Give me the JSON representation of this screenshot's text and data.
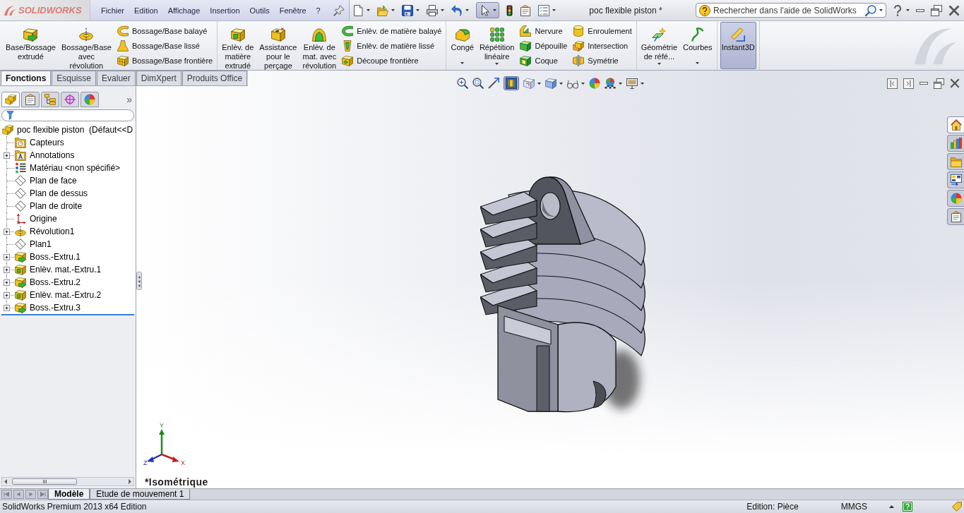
{
  "app_bar": {
    "logo": "SOLIDWORKS",
    "menu": [
      "Fichier",
      "Edition",
      "Affichage",
      "Insertion",
      "Outils",
      "Fenêtre",
      "?"
    ],
    "select_tool": {
      "pressed": true
    },
    "document_title": "poc flexible piston *",
    "search": {
      "placeholder": "Rechercher dans l'aide de SolidWorks"
    }
  },
  "ribbon": {
    "groups": [
      {
        "items": [
          {
            "kind": "large",
            "label": "Base/Bossage\nextrudé",
            "pressed": false
          },
          {
            "kind": "large",
            "label": "Bossage/Base\navec\nrévolution",
            "pressed": false
          },
          {
            "kind": "stack",
            "entries": [
              "Bossage/Base balayé",
              "Bossage/Base lissé",
              "Bossage/Base frontière"
            ]
          }
        ]
      },
      {
        "items": [
          {
            "kind": "large",
            "label": "Enlèv. de\nmatière\nextrudé",
            "pressed": false
          },
          {
            "kind": "large",
            "label": "Assistance\npour le\nperçage",
            "pressed": false
          },
          {
            "kind": "large",
            "label": "Enlèv. de\nmat. avec\nrévolution",
            "pressed": false
          },
          {
            "kind": "stack",
            "entries": [
              "Enlèv. de matière balayé",
              "Enlèv. de matière lissé",
              "Découpe frontière"
            ]
          }
        ]
      },
      {
        "items": [
          {
            "kind": "large",
            "label": "Congé",
            "dropdown": true,
            "pressed": false
          },
          {
            "kind": "large",
            "label": "Répétition\nlinéaire",
            "dropdown": true,
            "pressed": false
          },
          {
            "kind": "stack",
            "entries": [
              "Nervure",
              "Dépouille",
              "Coque"
            ]
          },
          {
            "kind": "stack",
            "entries": [
              "Enroulement",
              "Intersection",
              "Symétrie"
            ]
          }
        ]
      },
      {
        "items": [
          {
            "kind": "large",
            "label": "Géométrie\nde réfé...",
            "dropdown": true,
            "pressed": false
          },
          {
            "kind": "large",
            "label": "Courbes",
            "dropdown": true,
            "pressed": false
          }
        ]
      },
      {
        "items": [
          {
            "kind": "large",
            "label": "Instant3D",
            "pressed": true
          }
        ]
      }
    ]
  },
  "command_tabs": [
    {
      "label": "Fonctions",
      "selected": true
    },
    {
      "label": "Esquisse",
      "selected": false
    },
    {
      "label": "Evaluer",
      "selected": false
    },
    {
      "label": "DimXpert",
      "selected": false
    },
    {
      "label": "Produits Office",
      "selected": false
    }
  ],
  "view_toolbar": {
    "section_view": {
      "pressed": true
    }
  },
  "feature_manager": {
    "tabs": [
      {
        "selected": true
      },
      {
        "selected": false
      },
      {
        "selected": false
      },
      {
        "selected": false
      },
      {
        "selected": false
      }
    ],
    "more": "»",
    "tree": {
      "label": "poc flexible piston  (Défaut<<D",
      "children": [
        {
          "label": "Capteurs",
          "kind": "sensors",
          "expander": false
        },
        {
          "label": "Annotations",
          "kind": "annotations",
          "expander": true
        },
        {
          "label": "Matériau <non spécifié>",
          "kind": "material",
          "expander": false
        },
        {
          "label": "Plan de face",
          "kind": "plane",
          "expander": false
        },
        {
          "label": "Plan de dessus",
          "kind": "plane",
          "expander": false
        },
        {
          "label": "Plan de droite",
          "kind": "plane",
          "expander": false
        },
        {
          "label": "Origine",
          "kind": "origin",
          "expander": false
        },
        {
          "label": "Révolution1",
          "kind": "revolve",
          "expander": true
        },
        {
          "label": "Plan1",
          "kind": "plane",
          "expander": false
        },
        {
          "label": "Boss.-Extru.1",
          "kind": "boss",
          "expander": true
        },
        {
          "label": "Enlèv. mat.-Extru.1",
          "kind": "cut",
          "expander": true
        },
        {
          "label": "Boss.-Extru.2",
          "kind": "boss",
          "expander": true
        },
        {
          "label": "Enlèv. mat.-Extru.2",
          "kind": "cut",
          "expander": true
        },
        {
          "label": "Boss.-Extru.3",
          "kind": "boss",
          "expander": true
        }
      ]
    }
  },
  "viewport": {
    "view_name": "*Isométrique",
    "triad": {
      "y": "Y",
      "x": "X",
      "z": "Z"
    }
  },
  "task_pane": [
    {
      "selected": true
    },
    {
      "selected": false
    },
    {
      "selected": false
    },
    {
      "selected": false
    },
    {
      "selected": false
    },
    {
      "selected": false
    }
  ],
  "bottom_tabs": [
    {
      "label": "Modèle",
      "selected": true
    },
    {
      "label": "Etude de mouvement 1",
      "selected": false
    }
  ],
  "status_bar": {
    "product": "SolidWorks Premium 2013 x64 Edition",
    "mode": "Edition: Pièce",
    "units": "MMGS"
  }
}
